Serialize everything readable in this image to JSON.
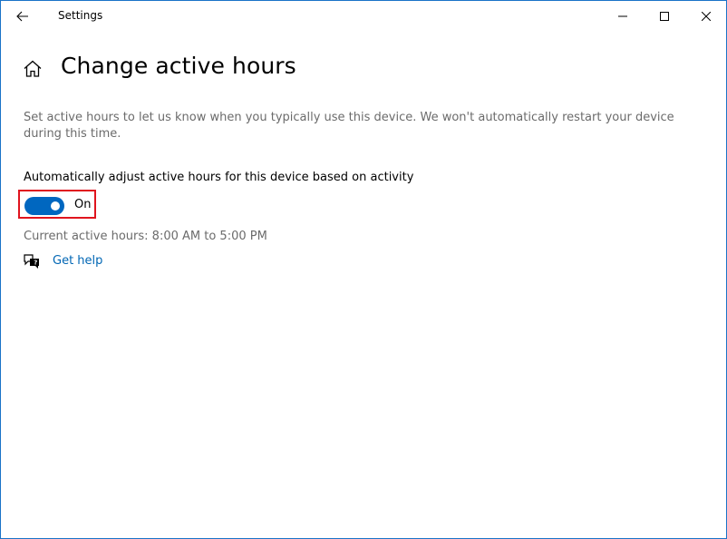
{
  "window": {
    "title": "Settings"
  },
  "page": {
    "title": "Change active hours",
    "description": "Set active hours to let us know when you typically use this device. We won't automatically restart your device during this time."
  },
  "auto_adjust": {
    "label": "Automatically adjust active hours for this device based on activity",
    "state_text": "On",
    "enabled": true
  },
  "current_hours": "Current active hours: 8:00 AM to 5:00 PM",
  "help": {
    "link_text": "Get help"
  },
  "colors": {
    "accent": "#0067c0",
    "highlight_border": "#e0141e",
    "link": "#0066b4",
    "secondary_text": "#6b6b6b"
  }
}
